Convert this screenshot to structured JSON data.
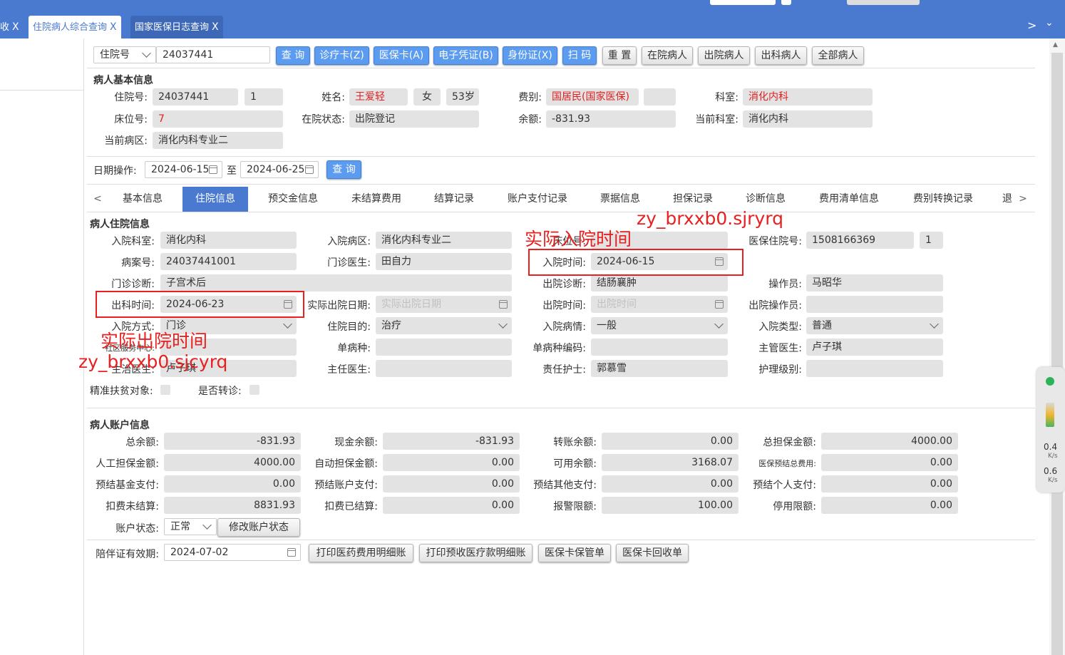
{
  "tabs": [
    {
      "label": "收",
      "close": "X"
    },
    {
      "label": "住院病人综合查询",
      "close": "X"
    },
    {
      "label": "国家医保日志查询",
      "close": "X"
    }
  ],
  "search": {
    "type": "住院号",
    "value": "24037441",
    "buttons": [
      "查 询",
      "诊疗卡(Z)",
      "医保卡(A)",
      "电子凭证(B)",
      "身份证(X)",
      "扫 码"
    ],
    "grey_buttons": [
      "重 置",
      "在院病人",
      "出院病人",
      "出科病人",
      "全部病人"
    ]
  },
  "basic": {
    "title": "病人基本信息",
    "zyh_label": "住院号:",
    "zyh": "24037441",
    "zyh_n": "1",
    "name_label": "姓名:",
    "name": "王爱轻",
    "sex": "女",
    "age": "53岁",
    "fb_label": "费别:",
    "fb": "国居民(国家医保)",
    "ks_label": "科室:",
    "ks": "消化内科",
    "cw_label": "床位号:",
    "cw": "7",
    "zyzt_label": "在院状态:",
    "zyzt": "出院登记",
    "ye_label": "余额:",
    "ye": "-831.93",
    "dqks_label": "当前科室:",
    "dqks": "消化内科",
    "dqbq_label": "当前病区:",
    "dqbq": "消化内科专业二"
  },
  "date_op": {
    "label": "日期操作:",
    "from": "2024-06-15",
    "to_label": "至",
    "to": "2024-06-25",
    "query": "查 询"
  },
  "nav_tabs": [
    "基本信息",
    "住院信息",
    "预交金信息",
    "未结算费用",
    "结算记录",
    "账户支付记录",
    "票据信息",
    "担保记录",
    "诊断信息",
    "费用清单信息",
    "费别转换记录",
    "退"
  ],
  "nav_arrows": {
    "left": "<",
    "right": ">"
  },
  "inpatient": {
    "title": "病人住院信息",
    "ryks_label": "入院科室:",
    "ryks": "消化内科",
    "rybq_label": "入院病区:",
    "rybq": "消化内科专业二",
    "cwh_label": "床位号:",
    "ybzyh_label": "医保住院号:",
    "ybzyh": "1508166369",
    "ybzyh_n": "1",
    "bah_label": "病案号:",
    "bah": "24037441001",
    "mzys_label": "门诊医生:",
    "mzys": "田自力",
    "rysj_label": "入院时间:",
    "rysj": "2024-06-15",
    "mzzd_label": "门诊诊断:",
    "mzzd": "子宫术后",
    "cyzd_label": "出院诊断:",
    "cyzd": "结肠襄肿",
    "czy_label": "操作员:",
    "czy": "马昭华",
    "cksj_label": "出科时间:",
    "cksj": "2024-06-23",
    "sjcyrq_label": "实际出院日期:",
    "sjcyrq_ph": "实际出院日期",
    "cysj_label": "出院时间:",
    "cysj_ph": "出院时间",
    "cyczy_label": "出院操作员:",
    "ryfs_label": "入院方式:",
    "ryfs": "门诊",
    "zymd_label": "住院目的:",
    "zymd": "治疗",
    "rybq2_label": "入院病情:",
    "rybq2": "一般",
    "rylx_label": "入院类型:",
    "rylx": "普通",
    "sqfwzx_label": "社区服务中心:",
    "dbz_label": "单病种:",
    "dbzbm_label": "单病种编码:",
    "zgys_label": "主管医生:",
    "zgys": "卢子琪",
    "zzys_label": "主治医生:",
    "zzys": "卢子琪",
    "zrys_label": "主任医生:",
    "zrhs_label": "责任护士:",
    "zrhs": "郭慕雪",
    "hljb_label": "护理级别:",
    "jzfp_label": "精准扶贫对象:",
    "sfzz_label": "是否转诊:"
  },
  "account": {
    "title": "病人账户信息",
    "rows": [
      [
        {
          "label": "总余额:",
          "value": "-831.93"
        },
        {
          "label": "现金余额:",
          "value": "-831.93"
        },
        {
          "label": "转账余额:",
          "value": "0.00"
        },
        {
          "label": "总担保金额:",
          "value": "4000.00"
        }
      ],
      [
        {
          "label": "人工担保金额:",
          "value": "4000.00"
        },
        {
          "label": "自动担保金额:",
          "value": "0.00"
        },
        {
          "label": "可用余额:",
          "value": "3168.07"
        },
        {
          "label": "医保预结总费用:",
          "value": "0.00"
        }
      ],
      [
        {
          "label": "预结基金支付:",
          "value": "0.00"
        },
        {
          "label": "预结账户支付:",
          "value": "0.00"
        },
        {
          "label": "预结其他支付:",
          "value": "0.00"
        },
        {
          "label": "预结个人支付:",
          "value": "0.00"
        }
      ],
      [
        {
          "label": "扣费未结算:",
          "value": "8831.93"
        },
        {
          "label": "扣费已结算:",
          "value": "0.00"
        },
        {
          "label": "报警限额:",
          "value": "100.00"
        },
        {
          "label": "停用限额:",
          "value": "0.00"
        }
      ]
    ],
    "status_label": "账户状态:",
    "status": "正常",
    "modify_btn": "修改账户状态"
  },
  "bottom": {
    "pz_label": "陪伴证有效期:",
    "pz": "2024-07-02",
    "buttons": [
      "打印医药费用明细账",
      "打印预收医疗款明细账",
      "医保卡保管单",
      "医保卡回收单"
    ]
  },
  "annotations": {
    "ry_title": "实际入院时间",
    "ry_code": "zy_brxxb0.sjryrq",
    "cy_title": "实际出院时间",
    "cy_code": "zy_brxxb0.sjcyrq"
  },
  "network": {
    "up": "0.4",
    "down": "0.6",
    "unit": "K/s"
  },
  "colors": {
    "header": "#4a7ad0",
    "primary_button": "#5b9bf0",
    "annotation": "#e82020"
  }
}
